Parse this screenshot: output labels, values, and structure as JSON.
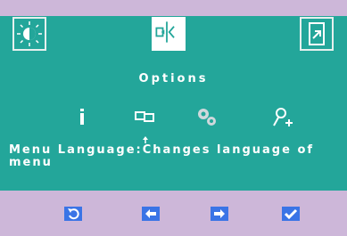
{
  "menu": {
    "title": "Options",
    "description_label": "Menu Language:",
    "description_text": "Changes language of menu"
  },
  "colors": {
    "panel": "#23a69a",
    "frame": "#cdb7d9",
    "nav_button": "#3a74e6"
  },
  "icons": {
    "top": [
      "brightness-icon",
      "position-icon",
      "exit-icon"
    ],
    "options": [
      "info-icon",
      "input-source-icon",
      "settings-gears-icon",
      "user-add-icon"
    ],
    "nav": [
      "undo-icon",
      "left-arrow-icon",
      "right-arrow-icon",
      "checkmark-icon"
    ]
  }
}
